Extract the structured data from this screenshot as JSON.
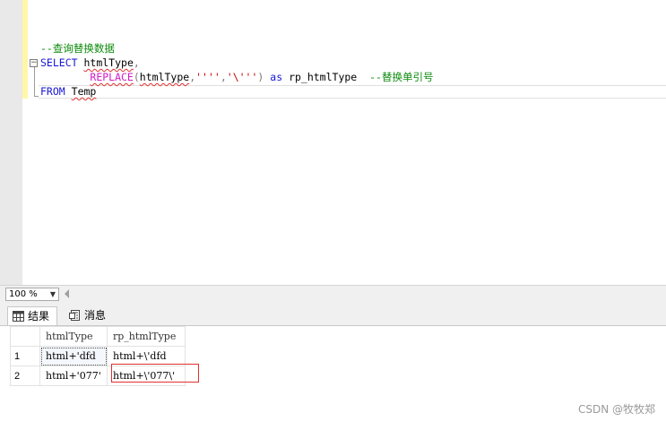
{
  "editor": {
    "lines": {
      "comment1": "--查询替换数据",
      "select_kw": "SELECT",
      "select_col": "htmlType",
      "select_comma": ",",
      "replace_fn": "REPLACE",
      "replace_open": "(",
      "replace_arg": "htmlType",
      "replace_comma1": ",",
      "replace_str1": "''''",
      "replace_comma2": ",",
      "replace_str2": "'\\'''",
      "replace_close": ")",
      "as_kw": "as",
      "alias": "rp_htmlType",
      "comment2": "--替换单引号",
      "from_kw": "FROM",
      "table_name": "Temp"
    }
  },
  "zoom": {
    "value": "100 %"
  },
  "tabs": [
    {
      "label": "结果",
      "icon": "grid-icon"
    },
    {
      "label": "消息",
      "icon": "message-icon"
    }
  ],
  "results": {
    "columns": [
      "htmlType",
      "rp_htmlType"
    ],
    "rows": [
      {
        "num": "1",
        "htmlType": "html+'dfd",
        "rp_htmlType": "html+\\'dfd"
      },
      {
        "num": "2",
        "htmlType": "html+'077'",
        "rp_htmlType": "html+\\'077\\'"
      }
    ]
  },
  "watermark": "CSDN @牧牧郑"
}
